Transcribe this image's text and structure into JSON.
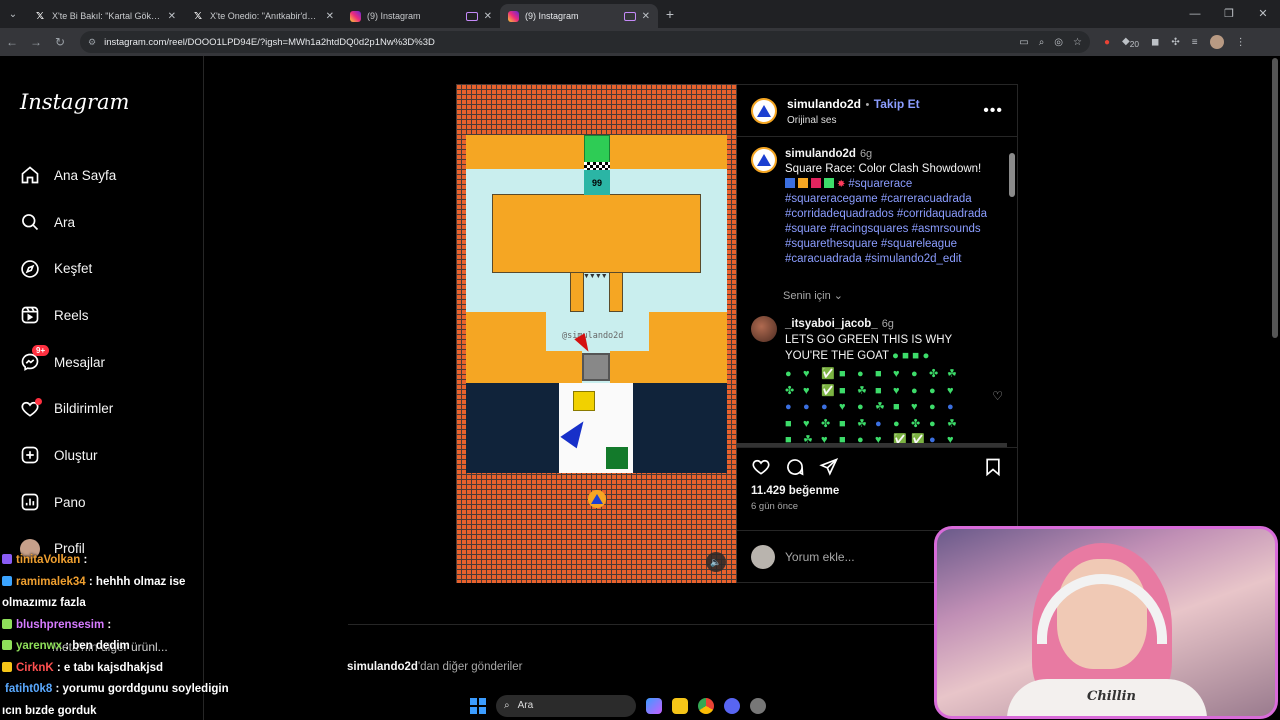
{
  "browser": {
    "tabs": [
      {
        "title": "X'te Bi Bakıl: \"Kartal Gökberk isi\"",
        "type": "x"
      },
      {
        "title": "X'te Onedio: \"Anıtkabir'de yürü\"",
        "type": "x"
      },
      {
        "title": "(9) Instagram",
        "type": "ig"
      },
      {
        "title": "(9) Instagram",
        "type": "ig",
        "active": true
      }
    ],
    "url": "instagram.com/reel/DOOO1LPD94E/?igsh=MWh1a2htdDQ0d2p1Nw%3D%3D",
    "extension_badge": "20"
  },
  "sidebar": {
    "logo": "Instagram",
    "items": [
      {
        "label": "Ana Sayfa",
        "icon": "home-icon"
      },
      {
        "label": "Ara",
        "icon": "search-icon"
      },
      {
        "label": "Keşfet",
        "icon": "compass-icon"
      },
      {
        "label": "Reels",
        "icon": "reels-icon"
      },
      {
        "label": "Mesajlar",
        "icon": "messenger-icon",
        "badge": "9+"
      },
      {
        "label": "Bildirimler",
        "icon": "heart-icon"
      },
      {
        "label": "Oluştur",
        "icon": "plus-icon"
      },
      {
        "label": "Pano",
        "icon": "dashboard-icon"
      },
      {
        "label": "Profil",
        "icon": "profile-avatar"
      }
    ]
  },
  "reel": {
    "counter": "99",
    "watermark": "@simulando2d"
  },
  "post": {
    "username": "simulando2d",
    "follow": "Takip Et",
    "separator": "•",
    "audio": "Orijinal ses",
    "caption_time": "6g",
    "caption_title": "Square Race: Color Clash Showdown!",
    "caption_tags": "#squarerace #squareracegame #carreracuadrada #corridadequadrados #corridaquadrada #square #racingsquares #asmrsounds #squarethesquare #squareleague #caracuadrada #simulando2d_edit",
    "translate": "Senin için",
    "comment_user": "_itsyaboi_jacob_",
    "comment_time": "6g",
    "comment_text": "LETS GO GREEN THIS IS WHY YOU'RE THE GOAT",
    "likes": "11.429 beğenme",
    "ago": "6 gün önce",
    "comment_placeholder": "Yorum ekle..."
  },
  "more_posts": {
    "user": "simulando2d",
    "rest": "'dan diğer gönderiler"
  },
  "chat": [
    {
      "user": "tinitaVolkan",
      "msg": ":",
      "color": "#f0a030"
    },
    {
      "user": "ramimalek34",
      "msg": ": hehhh olmaz ise",
      "color": "#f0a030"
    },
    {
      "user": "olmazımız",
      "msg": "fazla",
      "color": "#ffffff"
    },
    {
      "user": "blushprensesim",
      "msg": ":",
      "color": "#d67bff"
    },
    {
      "user": "yarenwx",
      "msg": ": ben dedim",
      "color": "#8fe05a"
    },
    {
      "user": "CirknK",
      "msg": ": e tabı kajsdhakjsd",
      "color": "#ff5050"
    },
    {
      "user": "fatiht0k8",
      "msg": ": yorumu gorddgunu soyledigin",
      "color": "#5aa9ff"
    },
    {
      "user": "",
      "msg": "ıcın bızde gorduk",
      "color": "#ffffff"
    }
  ],
  "ghost_text": "Meta'nın diğer ürünl...",
  "taskbar": {
    "search": "Ara"
  },
  "webcam": {
    "shirt": "Chillin"
  }
}
